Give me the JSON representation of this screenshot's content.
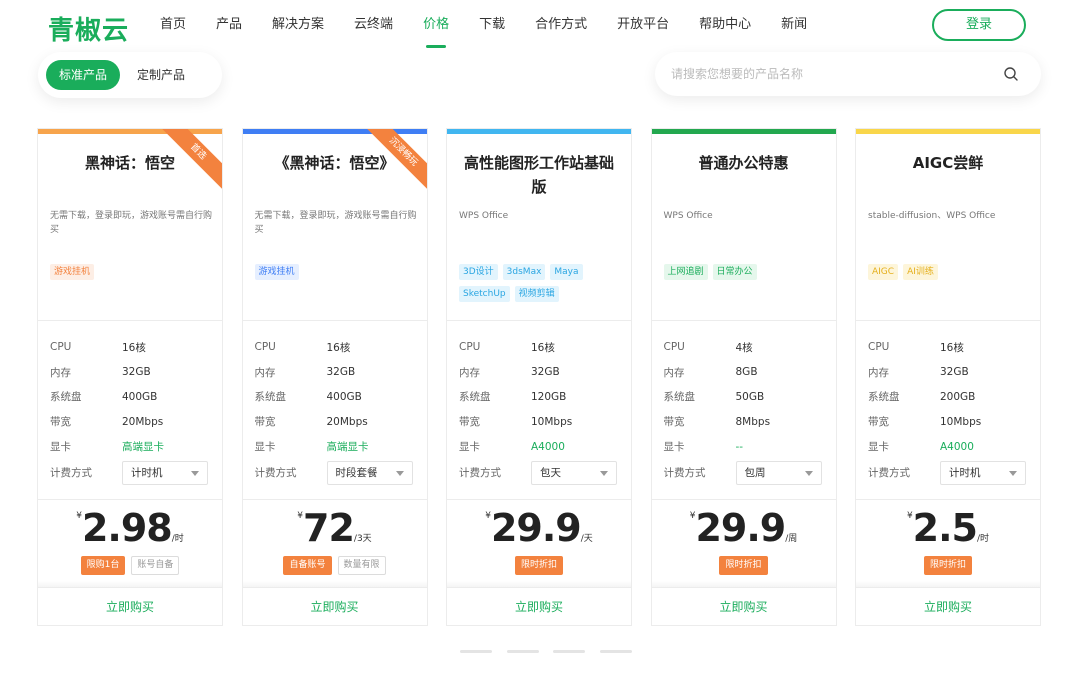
{
  "brand": {
    "logo": "青椒云",
    "accent": "#1aad5b"
  },
  "nav": {
    "items": [
      "首页",
      "产品",
      "解决方案",
      "云终端",
      "价格",
      "下载",
      "合作方式",
      "开放平台",
      "帮助中心",
      "新闻"
    ],
    "active": "价格",
    "login": "登录"
  },
  "tabs": [
    "标准产品",
    "定制产品"
  ],
  "search": {
    "placeholder": "请搜索您想要的产品名称"
  },
  "spec_labels": {
    "cpu": "CPU",
    "mem": "内存",
    "disk": "系统盘",
    "bw": "带宽",
    "gpu": "显卡",
    "billing": "计费方式"
  },
  "currency": "¥",
  "buy_label": "立即购买",
  "cards": [
    {
      "title": "黑神话：悟空",
      "ribbon": "首选",
      "top_color": "#f7a44c",
      "desc": "无需下载，登录即玩，游戏账号需自行购买",
      "tags": [
        {
          "text": "游戏挂机",
          "style": "orange"
        }
      ],
      "cpu": "16核",
      "mem": "32GB",
      "disk": "400GB",
      "bw": "20Mbps",
      "gpu": "高端显卡",
      "billing": "计时机",
      "price": "2.98",
      "unit": "/时",
      "badges": [
        {
          "text": "限购1台",
          "style": "solid"
        },
        {
          "text": "账号自备",
          "style": "outline"
        }
      ]
    },
    {
      "title": "《黑神话：悟空》",
      "ribbon": "沉浸畅玩",
      "top_color": "#3f7ef4",
      "desc": "无需下载，登录即玩，游戏账号需自行购买",
      "tags": [
        {
          "text": "游戏挂机",
          "style": "blue"
        }
      ],
      "cpu": "16核",
      "mem": "32GB",
      "disk": "400GB",
      "bw": "20Mbps",
      "gpu": "高端显卡",
      "billing": "时段套餐",
      "price": "72",
      "unit": "/3天",
      "badges": [
        {
          "text": "自备账号",
          "style": "solid"
        },
        {
          "text": "数量有限",
          "style": "outline"
        }
      ]
    },
    {
      "title": "高性能图形工作站基础版",
      "ribbon": "",
      "top_color": "#41b6f0",
      "desc": "WPS Office",
      "tags": [
        {
          "text": "3D设计",
          "style": "cyan"
        },
        {
          "text": "3dsMax",
          "style": "cyan"
        },
        {
          "text": "Maya",
          "style": "cyan"
        },
        {
          "text": "SketchUp",
          "style": "cyan"
        },
        {
          "text": "视频剪辑",
          "style": "cyan"
        }
      ],
      "cpu": "16核",
      "mem": "32GB",
      "disk": "120GB",
      "bw": "10Mbps",
      "gpu": "A4000",
      "billing": "包天",
      "price": "29.9",
      "unit": "/天",
      "badges": [
        {
          "text": "限时折扣",
          "style": "solid"
        }
      ]
    },
    {
      "title": "普通办公特惠",
      "ribbon": "",
      "top_color": "#23a84f",
      "desc": "WPS Office",
      "tags": [
        {
          "text": "上网追剧",
          "style": "green"
        },
        {
          "text": "日常办公",
          "style": "green"
        }
      ],
      "cpu": "4核",
      "mem": "8GB",
      "disk": "50GB",
      "bw": "8Mbps",
      "gpu": "--",
      "billing": "包周",
      "price": "29.9",
      "unit": "/周",
      "badges": [
        {
          "text": "限时折扣",
          "style": "solid"
        }
      ]
    },
    {
      "title": "AIGC尝鲜",
      "ribbon": "",
      "top_color": "#f9d64a",
      "desc": "stable-diffusion、WPS Office",
      "tags": [
        {
          "text": "AIGC",
          "style": "yellow"
        },
        {
          "text": "AI训练",
          "style": "yellow"
        }
      ],
      "cpu": "16核",
      "mem": "32GB",
      "disk": "200GB",
      "bw": "10Mbps",
      "gpu": "A4000",
      "billing": "计时机",
      "price": "2.5",
      "unit": "/时",
      "badges": [
        {
          "text": "限时折扣",
          "style": "solid"
        }
      ]
    }
  ],
  "pager_count": 4
}
